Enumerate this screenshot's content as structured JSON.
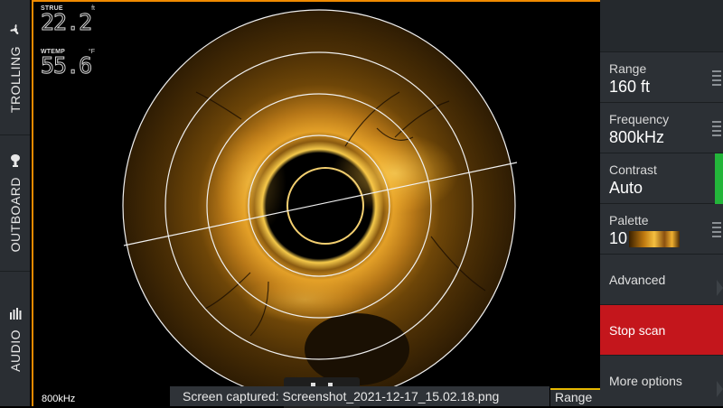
{
  "left_tabs": [
    {
      "label": "TROLLING",
      "icon": "propeller-icon"
    },
    {
      "label": "OUTBOARD",
      "icon": "outboard-motor-icon"
    },
    {
      "label": "AUDIO",
      "icon": "equalizer-icon"
    }
  ],
  "readouts": [
    {
      "label": "STRUE",
      "unit": "ft",
      "value": "22.2"
    },
    {
      "label": "WTEMP",
      "unit": "°F",
      "value": "55.6"
    }
  ],
  "sonar": {
    "frequency_label": "800kHz",
    "toast": "Screen captured: Screenshot_2021-12-17_15.02.18.png",
    "range_tab": "Range",
    "pause_icon": "pause-icon"
  },
  "menu": {
    "range": {
      "label": "Range",
      "value": "160 ft"
    },
    "frequency": {
      "label": "Frequency",
      "value": "800kHz"
    },
    "contrast": {
      "label": "Contrast",
      "value": "Auto"
    },
    "palette": {
      "label": "Palette",
      "value": "10"
    },
    "advanced": {
      "label": "Advanced"
    },
    "stop_scan": {
      "label": "Stop scan"
    },
    "more_options": {
      "label": "More options"
    }
  },
  "colors": {
    "accent_orange": "#f08a00",
    "stop_red": "#c4161c",
    "contrast_green": "#23b53a",
    "panel": "#2c3035"
  }
}
